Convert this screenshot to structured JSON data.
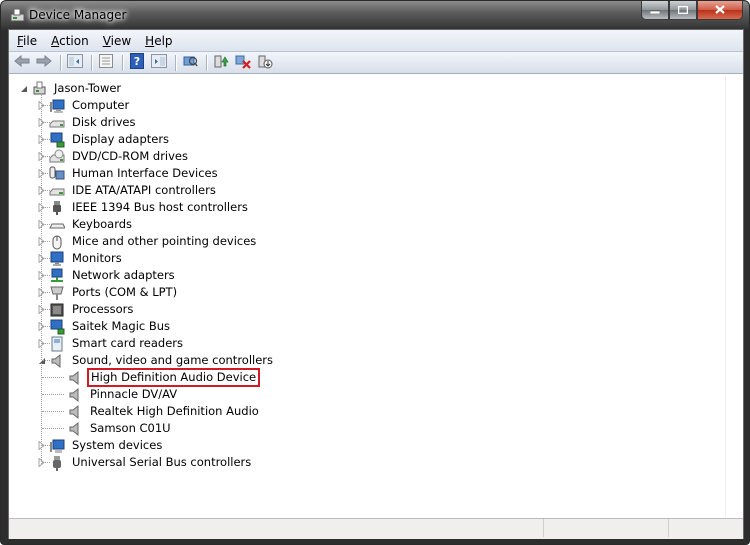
{
  "window": {
    "title": "Device Manager",
    "controls": {
      "minimize": "minimize-icon",
      "maximize": "maximize-icon",
      "close": "close-icon"
    }
  },
  "menu": [
    {
      "label": "File",
      "accel": "F",
      "rest": "ile"
    },
    {
      "label": "Action",
      "accel": "A",
      "rest": "ction"
    },
    {
      "label": "View",
      "accel": "V",
      "rest": "iew"
    },
    {
      "label": "Help",
      "accel": "H",
      "rest": "elp"
    }
  ],
  "toolbar": [
    {
      "name": "back",
      "icon": "arrow-left-icon"
    },
    {
      "name": "forward",
      "icon": "arrow-right-icon"
    },
    {
      "name": "show-hide-console-tree",
      "icon": "console-tree-icon"
    },
    {
      "name": "properties",
      "icon": "properties-icon"
    },
    {
      "name": "help",
      "icon": "help-icon"
    },
    {
      "name": "show-action-pane",
      "icon": "action-pane-icon"
    },
    {
      "name": "scan-hardware-changes",
      "icon": "scan-hardware-icon"
    },
    {
      "name": "update-driver",
      "icon": "update-driver-icon"
    },
    {
      "name": "uninstall",
      "icon": "uninstall-icon"
    },
    {
      "name": "enable-device",
      "icon": "enable-device-icon"
    }
  ],
  "tree": {
    "root": {
      "label": "Jason-Tower",
      "icon": "computer-tower-icon",
      "expanded": true
    },
    "categories": [
      {
        "label": "Computer",
        "icon": "computer-icon",
        "expanded": false
      },
      {
        "label": "Disk drives",
        "icon": "disk-drive-icon",
        "expanded": false
      },
      {
        "label": "Display adapters",
        "icon": "display-adapter-icon",
        "expanded": false
      },
      {
        "label": "DVD/CD-ROM drives",
        "icon": "dvd-drive-icon",
        "expanded": false
      },
      {
        "label": "Human Interface Devices",
        "icon": "hid-icon",
        "expanded": false
      },
      {
        "label": "IDE ATA/ATAPI controllers",
        "icon": "ide-controller-icon",
        "expanded": false
      },
      {
        "label": "IEEE 1394 Bus host controllers",
        "icon": "firewire-icon",
        "expanded": false
      },
      {
        "label": "Keyboards",
        "icon": "keyboard-icon",
        "expanded": false
      },
      {
        "label": "Mice and other pointing devices",
        "icon": "mouse-icon",
        "expanded": false
      },
      {
        "label": "Monitors",
        "icon": "monitor-icon",
        "expanded": false
      },
      {
        "label": "Network adapters",
        "icon": "network-adapter-icon",
        "expanded": false
      },
      {
        "label": "Ports (COM & LPT)",
        "icon": "port-icon",
        "expanded": false
      },
      {
        "label": "Processors",
        "icon": "processor-icon",
        "expanded": false
      },
      {
        "label": "Saitek Magic Bus",
        "icon": "bus-icon",
        "expanded": false
      },
      {
        "label": "Smart card readers",
        "icon": "smart-card-icon",
        "expanded": false
      },
      {
        "label": "Sound, video and game controllers",
        "icon": "speaker-icon",
        "expanded": true,
        "children": [
          {
            "label": "High Definition Audio Device",
            "icon": "speaker-icon",
            "selected": true
          },
          {
            "label": "Pinnacle DV/AV",
            "icon": "speaker-icon"
          },
          {
            "label": "Realtek High Definition Audio",
            "icon": "speaker-icon"
          },
          {
            "label": "Samson C01U",
            "icon": "speaker-icon"
          }
        ]
      },
      {
        "label": "System devices",
        "icon": "system-devices-icon",
        "expanded": false
      },
      {
        "label": "Universal Serial Bus controllers",
        "icon": "usb-icon",
        "expanded": false
      }
    ]
  },
  "colors": {
    "highlight_box": "#d11b25"
  }
}
